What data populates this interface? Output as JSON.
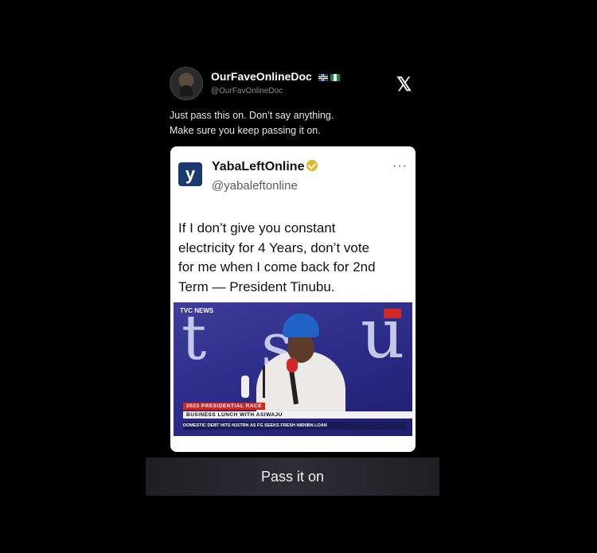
{
  "post": {
    "author_name": "OurFaveOnlineDoc",
    "author_handle": "@OurFavOnlineDoc",
    "text_line1": "Just pass this on. Don’t say anything.",
    "text_line2": "Make sure you keep passing it on."
  },
  "quoted": {
    "logo_letter": "y",
    "author_name": "YabaLeftOnline",
    "author_handle": "@yabaleftonline",
    "more": "···",
    "text_line1": "If I don’t give you constant",
    "text_line2": "electricity for 4 Years, don’t vote",
    "text_line3": "for me when I come back for 2nd",
    "text_line4": "Term — President Tinubu.",
    "video": {
      "channel": "TVC NEWS",
      "lower_third_top": "2023 PRESIDENTIAL RACE",
      "lower_third_bottom": "BUSINESS LUNCH WITH ASIWAJU",
      "ticker": "DOMESTIC DEBT HITS N15TRN AS FG SEEKS FRESH N800BN LOAN"
    }
  },
  "pass_button": "Pass it on",
  "colors": {
    "background": "#000000",
    "card": "#ffffff",
    "verified_badge": "#e4b528",
    "yaba_logo": "#1a3a6e"
  },
  "icons": [
    "x-logo-icon",
    "verified-icon",
    "flag-uk-icon",
    "flag-nigeria-icon",
    "more-icon"
  ]
}
